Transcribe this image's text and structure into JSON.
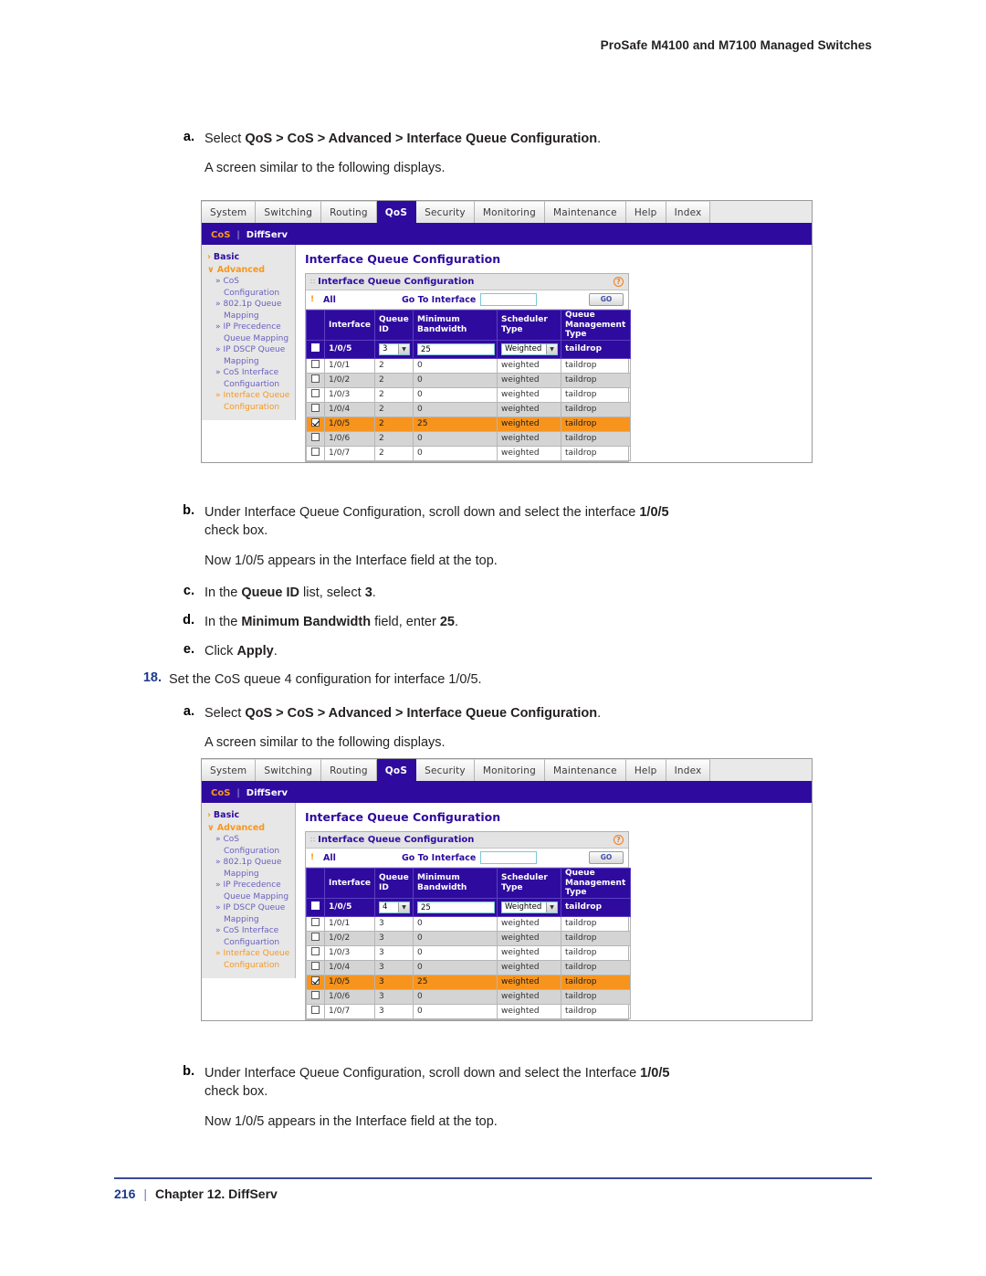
{
  "doc": {
    "running_header": "ProSafe M4100 and M7100 Managed Switches",
    "footer_page": "216",
    "footer_separator": "|",
    "footer_chapter": "Chapter 12. DiffServ"
  },
  "block1": {
    "a_marker": "a.",
    "a_text_lead": "Select ",
    "a_text_bold": "QoS > CoS > Advanced > Interface Queue Configuration",
    "a_text_tail": ".",
    "a_sub": "A screen similar to the following displays."
  },
  "block2": {
    "b_marker": "b.",
    "b_line1_lead": "Under Interface Queue Configuration, scroll down and select the interface ",
    "b_line1_bold": "1/0/5",
    "b_line2": "check box.",
    "b_sub": "Now 1/0/5 appears in the Interface field at the top.",
    "c_marker": "c.",
    "c_lead": "In the ",
    "c_bold": "Queue ID",
    "c_mid": " list, select ",
    "c_bold2": "3",
    "c_tail": ".",
    "d_marker": "d.",
    "d_lead": "In the ",
    "d_bold": "Minimum Bandwidth",
    "d_mid": " field, enter ",
    "d_bold2": "25",
    "d_tail": ".",
    "e_marker": "e.",
    "e_lead": "Click ",
    "e_bold": "Apply",
    "e_tail": "."
  },
  "step18": {
    "marker": "18.",
    "text": "Set the CoS queue 4 configuration for interface 1/0/5.",
    "a_marker": "a.",
    "a_text_lead": "Select ",
    "a_text_bold": "QoS > CoS > Advanced > Interface Queue Configuration",
    "a_text_tail": ".",
    "a_sub": "A screen similar to the following displays."
  },
  "block3": {
    "b_marker": "b.",
    "b_line1_lead": "Under Interface Queue Configuration, scroll down and select the Interface ",
    "b_line1_bold": "1/0/5",
    "b_line2": "check box.",
    "b_sub": "Now 1/0/5 appears in the Interface field at the top."
  },
  "app": {
    "tabs": [
      {
        "label": "System",
        "active": false
      },
      {
        "label": "Switching",
        "active": false
      },
      {
        "label": "Routing",
        "active": false
      },
      {
        "label": "QoS",
        "active": true
      },
      {
        "label": "Security",
        "active": false
      },
      {
        "label": "Monitoring",
        "active": false
      },
      {
        "label": "Maintenance",
        "active": false
      },
      {
        "label": "Help",
        "active": false
      },
      {
        "label": "Index",
        "active": false
      }
    ],
    "subnav": [
      {
        "label": "CoS",
        "active": true
      },
      {
        "label": "DiffServ",
        "active": false
      }
    ],
    "subnav_separator": "|",
    "sidebar": [
      {
        "label": "Basic",
        "level": 1,
        "caret": "›",
        "active": false
      },
      {
        "label": "Advanced",
        "level": 1,
        "caret": "∨",
        "active": true
      },
      {
        "label": "CoS",
        "label2": "Configuration",
        "level": 2,
        "caret": "»",
        "active": false
      },
      {
        "label": "802.1p Queue",
        "label2": "Mapping",
        "level": 2,
        "caret": "»",
        "active": false
      },
      {
        "label": "IP Precedence",
        "label2": "Queue Mapping",
        "level": 2,
        "caret": "»",
        "active": false
      },
      {
        "label": "IP DSCP Queue",
        "label2": "Mapping",
        "level": 2,
        "caret": "»",
        "active": false
      },
      {
        "label": "CoS Interface",
        "label2": "Configuartion",
        "level": 2,
        "caret": "»",
        "active": false
      },
      {
        "label": "Interface Queue",
        "label2": "Configuration",
        "level": 2,
        "caret": "»",
        "active": true
      }
    ],
    "page_title": "Interface Queue Configuration",
    "panel_title": "Interface Queue Configuration",
    "help_icon": "?",
    "filter_marker": "!",
    "filter_all": "All",
    "goto_label": "Go To Interface",
    "goto_value": "",
    "go_button": "GO",
    "columns": [
      "",
      "Interface",
      "Queue ID",
      "Minimum Bandwidth",
      "Scheduler Type",
      "Queue Management Type"
    ],
    "colors": {
      "purple": "#2E0B9E",
      "orange": "#F7941D",
      "accent_link": "#6A5FBF",
      "alt_row": "#D4D4D4"
    }
  },
  "screenshot1": {
    "edit_row": {
      "checked": false,
      "interface": "1/0/5",
      "queue_id": "3",
      "min_bandwidth": "25",
      "scheduler_type": "Weighted",
      "queue_mgmt_type": "taildrop"
    },
    "rows": [
      {
        "checked": false,
        "interface": "1/0/1",
        "queue_id": "2",
        "min_bandwidth": "0",
        "scheduler_type": "weighted",
        "queue_mgmt_type": "taildrop",
        "highlight": false
      },
      {
        "checked": false,
        "interface": "1/0/2",
        "queue_id": "2",
        "min_bandwidth": "0",
        "scheduler_type": "weighted",
        "queue_mgmt_type": "taildrop",
        "highlight": false
      },
      {
        "checked": false,
        "interface": "1/0/3",
        "queue_id": "2",
        "min_bandwidth": "0",
        "scheduler_type": "weighted",
        "queue_mgmt_type": "taildrop",
        "highlight": false
      },
      {
        "checked": false,
        "interface": "1/0/4",
        "queue_id": "2",
        "min_bandwidth": "0",
        "scheduler_type": "weighted",
        "queue_mgmt_type": "taildrop",
        "highlight": false
      },
      {
        "checked": true,
        "interface": "1/0/5",
        "queue_id": "2",
        "min_bandwidth": "25",
        "scheduler_type": "weighted",
        "queue_mgmt_type": "taildrop",
        "highlight": true
      },
      {
        "checked": false,
        "interface": "1/0/6",
        "queue_id": "2",
        "min_bandwidth": "0",
        "scheduler_type": "weighted",
        "queue_mgmt_type": "taildrop",
        "highlight": false
      },
      {
        "checked": false,
        "interface": "1/0/7",
        "queue_id": "2",
        "min_bandwidth": "0",
        "scheduler_type": "weighted",
        "queue_mgmt_type": "taildrop",
        "highlight": false
      }
    ]
  },
  "screenshot2": {
    "edit_row": {
      "checked": false,
      "interface": "1/0/5",
      "queue_id": "4",
      "min_bandwidth": "25",
      "scheduler_type": "Weighted",
      "queue_mgmt_type": "taildrop"
    },
    "rows": [
      {
        "checked": false,
        "interface": "1/0/1",
        "queue_id": "3",
        "min_bandwidth": "0",
        "scheduler_type": "weighted",
        "queue_mgmt_type": "taildrop",
        "highlight": false
      },
      {
        "checked": false,
        "interface": "1/0/2",
        "queue_id": "3",
        "min_bandwidth": "0",
        "scheduler_type": "weighted",
        "queue_mgmt_type": "taildrop",
        "highlight": false
      },
      {
        "checked": false,
        "interface": "1/0/3",
        "queue_id": "3",
        "min_bandwidth": "0",
        "scheduler_type": "weighted",
        "queue_mgmt_type": "taildrop",
        "highlight": false
      },
      {
        "checked": false,
        "interface": "1/0/4",
        "queue_id": "3",
        "min_bandwidth": "0",
        "scheduler_type": "weighted",
        "queue_mgmt_type": "taildrop",
        "highlight": false
      },
      {
        "checked": true,
        "interface": "1/0/5",
        "queue_id": "3",
        "min_bandwidth": "25",
        "scheduler_type": "weighted",
        "queue_mgmt_type": "taildrop",
        "highlight": true
      },
      {
        "checked": false,
        "interface": "1/0/6",
        "queue_id": "3",
        "min_bandwidth": "0",
        "scheduler_type": "weighted",
        "queue_mgmt_type": "taildrop",
        "highlight": false
      },
      {
        "checked": false,
        "interface": "1/0/7",
        "queue_id": "3",
        "min_bandwidth": "0",
        "scheduler_type": "weighted",
        "queue_mgmt_type": "taildrop",
        "highlight": false
      }
    ]
  }
}
